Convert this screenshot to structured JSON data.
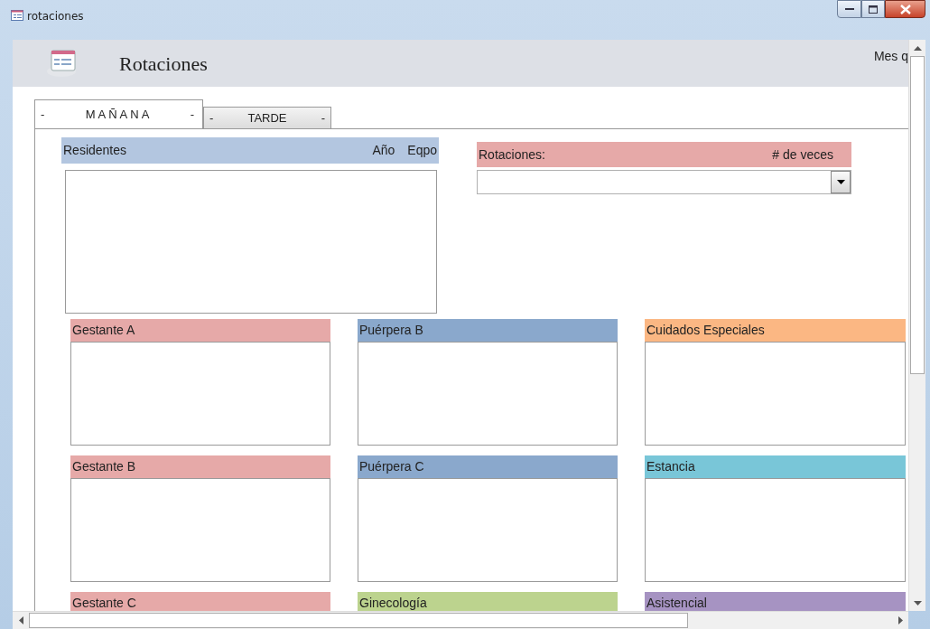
{
  "window": {
    "title": "rotaciones"
  },
  "header": {
    "title": "Rotaciones",
    "cut_text": "Mes q"
  },
  "tabs": [
    {
      "label": "MAÑANA",
      "left_mark": "-",
      "right_mark": "-",
      "selected": true
    },
    {
      "label": "TARDE",
      "left_mark": "-",
      "right_mark": "-",
      "selected": false
    }
  ],
  "residents": {
    "title": "Residentes",
    "columns": [
      "Año",
      "Eqpo"
    ]
  },
  "rotations": {
    "title": "Rotaciones:",
    "count_label": "# de veces"
  },
  "panels": [
    {
      "title": "Gestante A",
      "color": "#e6a9a8"
    },
    {
      "title": "Puérpera B",
      "color": "#8aa8cc"
    },
    {
      "title": "Cuidados Especiales",
      "color": "#fbb783"
    },
    {
      "title": "Gestante B",
      "color": "#e6a9a8"
    },
    {
      "title": "Puérpera C",
      "color": "#8aa8cc"
    },
    {
      "title": "Estancia",
      "color": "#79c6d8"
    },
    {
      "title": "Gestante C",
      "color": "#e6a9a8"
    },
    {
      "title": "Ginecología",
      "color": "#bcd38e"
    },
    {
      "title": "Asistencial",
      "color": "#a693c2"
    }
  ]
}
